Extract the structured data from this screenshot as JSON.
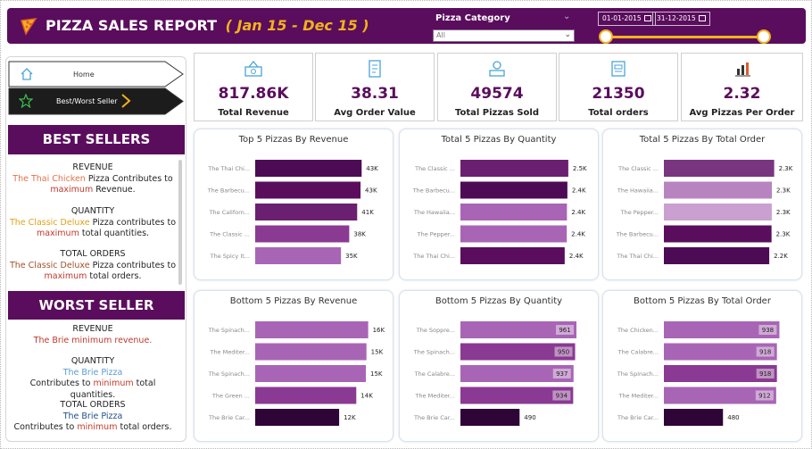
{
  "header": {
    "title": "PIZZA SALES REPORT",
    "date_range": "( Jan 15 - Dec 15 )",
    "category_label": "Pizza Category",
    "category_value": "All",
    "start_date": "01-01-2015",
    "end_date": "31-12-2015",
    "colors": {
      "banner": "#5a0d5d",
      "accent": "#f3b21a"
    }
  },
  "nav": {
    "home_label": "Home",
    "seller_label": "Best/Worst Seller",
    "home_icon": "home-icon",
    "seller_icon": "star-icon"
  },
  "best": {
    "banner": "BEST SELLERS",
    "revenue": {
      "head": "REVENUE",
      "pizza": "The Thai Chicken",
      "mid": "Pizza Contributes to",
      "key": "maximum",
      "tail": "Revenue."
    },
    "quantity": {
      "head": "QUANTITY",
      "pizza": "The Classic Deluxe",
      "mid": "Pizza contributes to",
      "key": "maximum",
      "tail": "total quantities."
    },
    "orders": {
      "head": "TOTAL ORDERS",
      "pizza": "The Classic Deluxe",
      "mid": "Pizza contributes to",
      "key": "maximum",
      "tail": "total orders."
    }
  },
  "worst": {
    "banner": "WORST SELLER",
    "revenue": {
      "head": "REVENUE",
      "line": "The Brie minimum revenue."
    },
    "quantity": {
      "head": "QUANTITY",
      "pizza": "The Brie Pizza",
      "pre": "Contributes to",
      "key": "minimum",
      "tail": "total quantities."
    },
    "orders": {
      "head": "TOTAL ORDERS",
      "pizza": "The Brie Pizza",
      "pre": "Contributes to",
      "key": "minimum",
      "tail": "total orders."
    }
  },
  "kpis": [
    {
      "value": "817.86K",
      "label": "Total Revenue",
      "icon": "revenue-icon"
    },
    {
      "value": "38.31",
      "label": "Avg Order Value",
      "icon": "receipt-icon"
    },
    {
      "value": "49574",
      "label": "Total Pizzas Sold",
      "icon": "pizza-delivery-icon"
    },
    {
      "value": "21350",
      "label": "Total orders",
      "icon": "orders-icon"
    },
    {
      "value": "2.32",
      "label": "Avg Pizzas Per Order",
      "icon": "bar-chart-icon"
    }
  ],
  "chart_data": [
    {
      "type": "bar",
      "orientation": "horizontal",
      "title": "Top 5 Pizzas By Revenue",
      "categories": [
        "The Thai Chi...",
        "The Barbecu...",
        "The Californ...",
        "The Classic ...",
        "The Spicy It..."
      ],
      "values": [
        43217,
        42768,
        41410,
        38180,
        34831
      ],
      "labels": [
        "43K",
        "43K",
        "41K",
        "38K",
        "35K"
      ],
      "xlim": [
        0,
        50000
      ],
      "label_position": "outside",
      "colors": [
        "#4d0a55",
        "#5a0d5d",
        "#6b1f70",
        "#8a3a93",
        "#a865b5"
      ]
    },
    {
      "type": "bar",
      "orientation": "horizontal",
      "title": "Total 5 Pizzas By Quantity",
      "categories": [
        "The Classic ...",
        "The Barbecu...",
        "The Hawaiia...",
        "The Pepper...",
        "The Thai Chi..."
      ],
      "values": [
        2453,
        2432,
        2422,
        2418,
        2371
      ],
      "labels": [
        "2.5K",
        "2.4K",
        "2.4K",
        "2.4K",
        "2.4K"
      ],
      "xlim": [
        0,
        2800
      ],
      "label_position": "outside",
      "colors": [
        "#6b1f70",
        "#4d0a55",
        "#a865b5",
        "#a865b5",
        "#5a0d5d"
      ]
    },
    {
      "type": "bar",
      "orientation": "horizontal",
      "title": "Total 5 Pizzas By Total Order",
      "categories": [
        "The Classic ...",
        "The Hawaiia...",
        "The Pepper...",
        "The Barbecu...",
        "The Thai Chi..."
      ],
      "values": [
        2329,
        2280,
        2278,
        2273,
        2225
      ],
      "labels": [
        "2.3K",
        "2.3K",
        "2.3K",
        "2.3K",
        "2.2K"
      ],
      "xlim": [
        0,
        2600
      ],
      "label_position": "outside",
      "colors": [
        "#7a3580",
        "#b784c0",
        "#c9a0d0",
        "#5a0d5d",
        "#4d0a55"
      ]
    },
    {
      "type": "bar",
      "orientation": "horizontal",
      "title": "Bottom 5 Pizzas By Revenue",
      "categories": [
        "The Spinach...",
        "The Mediter...",
        "The Spinach...",
        "The Green ...",
        "The Brie Car..."
      ],
      "values": [
        15596,
        15360,
        15277,
        13956,
        11588
      ],
      "labels": [
        "16K",
        "15K",
        "15K",
        "14K",
        "12K"
      ],
      "xlim": [
        0,
        17000
      ],
      "label_position": "outside",
      "colors": [
        "#a865b5",
        "#a865b5",
        "#a865b5",
        "#8a3a93",
        "#2e0536"
      ]
    },
    {
      "type": "bar",
      "orientation": "horizontal",
      "title": "Bottom 5 Pizzas By Quantity",
      "categories": [
        "The Soppre...",
        "The Spinach...",
        "The Calabre...",
        "The Mediter...",
        "The Brie Car..."
      ],
      "values": [
        961,
        950,
        937,
        934,
        490
      ],
      "labels": [
        "961",
        "950",
        "937",
        "934",
        "490"
      ],
      "xlim": [
        0,
        1020
      ],
      "label_position": "inside",
      "colors": [
        "#a865b5",
        "#8a3a93",
        "#a865b5",
        "#8a3a93",
        "#2e0536"
      ]
    },
    {
      "type": "bar",
      "orientation": "horizontal",
      "title": "Bottom 5 Pizzas By Total Order",
      "categories": [
        "The Chicken...",
        "The Calabre...",
        "The Spinach...",
        "The Mediter...",
        "The Brie Car..."
      ],
      "values": [
        938,
        918,
        918,
        912,
        480
      ],
      "labels": [
        "938",
        "918",
        "918",
        "912",
        "480"
      ],
      "xlim": [
        0,
        1000
      ],
      "label_position": "inside",
      "colors": [
        "#a865b5",
        "#a865b5",
        "#8a3a93",
        "#a865b5",
        "#2e0536"
      ]
    }
  ]
}
